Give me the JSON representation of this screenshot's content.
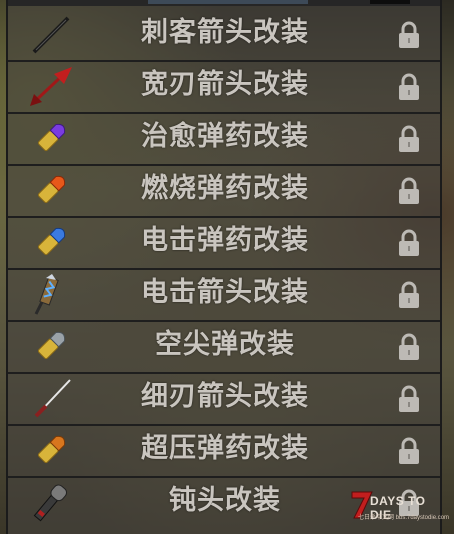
{
  "mod_list": {
    "items": [
      {
        "label": "刺客箭头改装",
        "icon": "assassin-arrow-icon",
        "locked": true
      },
      {
        "label": "宽刃箭头改装",
        "icon": "broadhead-arrow-icon",
        "locked": true
      },
      {
        "label": "治愈弹药改装",
        "icon": "purple-bullet-icon",
        "locked": true
      },
      {
        "label": "燃烧弹药改装",
        "icon": "orange-bullet-icon",
        "locked": true
      },
      {
        "label": "电击弹药改装",
        "icon": "blue-bullet-icon",
        "locked": true
      },
      {
        "label": "电击箭头改装",
        "icon": "shock-arrow-icon",
        "locked": true
      },
      {
        "label": "空尖弹改装",
        "icon": "gray-bullet-icon",
        "locked": true
      },
      {
        "label": "细刃箭头改装",
        "icon": "thin-blade-arrow-icon",
        "locked": true
      },
      {
        "label": "超压弹药改装",
        "icon": "amber-bullet-icon",
        "locked": true
      },
      {
        "label": "钝头改装",
        "icon": "blunt-tip-icon",
        "locked": true
      }
    ]
  },
  "watermark": {
    "title": "DAYS TO DIE",
    "subtitle": "七日杀中文网 bbs.7daystodie.com"
  },
  "colors": {
    "purple_tip": "#7a3ce0",
    "orange_tip": "#e8581a",
    "blue_tip": "#3a7ae0",
    "gray_tip": "#9aa2a8",
    "amber_tip": "#d8761e",
    "casing": "#d8b43a",
    "arrow_red": "#c21e1e"
  }
}
